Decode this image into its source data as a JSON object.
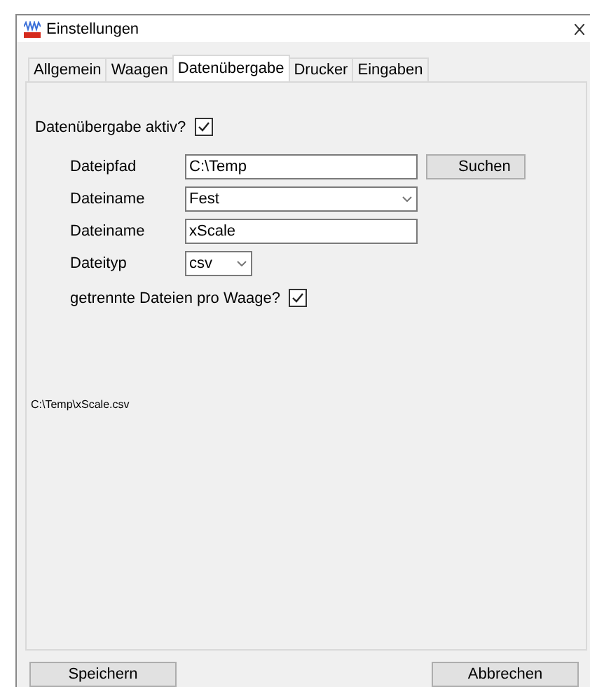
{
  "window": {
    "title": "Einstellungen"
  },
  "tabs": [
    {
      "label": "Allgemein",
      "selected": false
    },
    {
      "label": "Waagen",
      "selected": false
    },
    {
      "label": "Datenübergabe",
      "selected": true
    },
    {
      "label": "Drucker",
      "selected": false
    },
    {
      "label": "Eingaben",
      "selected": false
    }
  ],
  "active": {
    "label": "Datenübergabe aktiv?",
    "checked": true
  },
  "fields": [
    {
      "kind": "text",
      "label": "Dateipfad",
      "value": "C:\\Temp",
      "button": "Suchen"
    },
    {
      "kind": "combo",
      "label": "Dateiname",
      "value": "Fest"
    },
    {
      "kind": "text",
      "label": "Dateiname",
      "value": "xScale"
    },
    {
      "kind": "smallcombo",
      "label": "Dateityp",
      "value": "csv"
    }
  ],
  "separate": {
    "label": "getrennte Dateien pro Waage?",
    "checked": true
  },
  "preview_path": "C:\\Temp\\xScale.csv",
  "buttons": [
    "Speichern",
    "Abbrechen"
  ]
}
